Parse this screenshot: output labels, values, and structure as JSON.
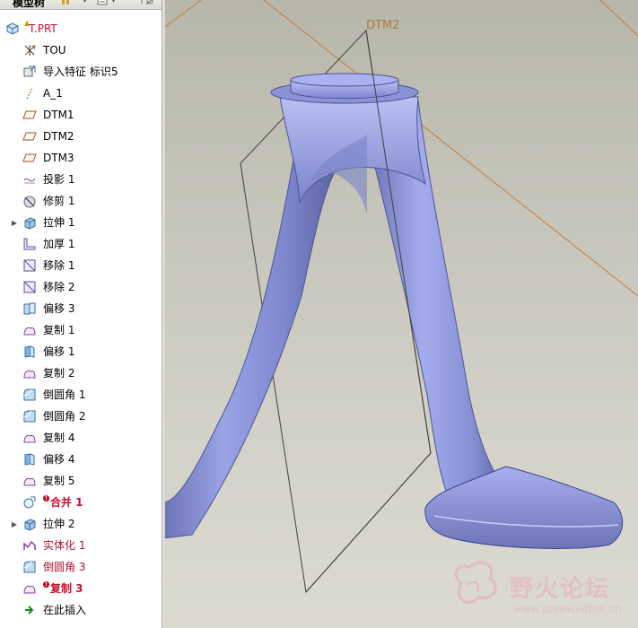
{
  "panel": {
    "title": "模型树"
  },
  "tree": {
    "root": {
      "label": "T.PRT",
      "icon": "part-cube-icon"
    },
    "items": [
      {
        "label": "TOU",
        "icon": "coordinate-system-icon",
        "expand": false,
        "state": "normal"
      },
      {
        "label": "导入特征 标识5",
        "icon": "import-feature-icon",
        "expand": false,
        "state": "normal"
      },
      {
        "label": "A_1",
        "icon": "datum-axis-icon",
        "expand": false,
        "state": "normal"
      },
      {
        "label": "DTM1",
        "icon": "datum-plane-icon",
        "expand": false,
        "state": "normal"
      },
      {
        "label": "DTM2",
        "icon": "datum-plane-icon",
        "expand": false,
        "state": "normal"
      },
      {
        "label": "DTM3",
        "icon": "datum-plane-icon",
        "expand": false,
        "state": "normal"
      },
      {
        "label": "投影 1",
        "icon": "project-curve-icon",
        "expand": false,
        "state": "normal"
      },
      {
        "label": "修剪 1",
        "icon": "trim-icon",
        "expand": false,
        "state": "normal"
      },
      {
        "label": "拉伸 1",
        "icon": "extrude-icon",
        "expand": true,
        "state": "normal"
      },
      {
        "label": "加厚 1",
        "icon": "thicken-icon",
        "expand": false,
        "state": "normal"
      },
      {
        "label": "移除 1",
        "icon": "remove-icon",
        "expand": false,
        "state": "normal"
      },
      {
        "label": "移除 2",
        "icon": "remove-icon",
        "expand": false,
        "state": "normal"
      },
      {
        "label": "偏移 3",
        "icon": "offset-icon",
        "expand": false,
        "state": "normal"
      },
      {
        "label": "复制 1",
        "icon": "copy-surface-icon",
        "expand": false,
        "state": "normal"
      },
      {
        "label": "偏移 1",
        "icon": "offset-surface-icon",
        "expand": false,
        "state": "normal"
      },
      {
        "label": "复制 2",
        "icon": "copy-surface-icon",
        "expand": false,
        "state": "normal"
      },
      {
        "label": "倒圆角 1",
        "icon": "round-icon",
        "expand": false,
        "state": "normal"
      },
      {
        "label": "倒圆角 2",
        "icon": "round-icon",
        "expand": false,
        "state": "normal"
      },
      {
        "label": "复制 4",
        "icon": "copy-surface-icon",
        "expand": false,
        "state": "normal"
      },
      {
        "label": "偏移 4",
        "icon": "offset-surface-icon",
        "expand": false,
        "state": "normal"
      },
      {
        "label": "复制 5",
        "icon": "copy-surface-icon",
        "expand": false,
        "state": "normal"
      },
      {
        "label": "合并 1",
        "icon": "merge-icon",
        "expand": false,
        "state": "failed"
      },
      {
        "label": "拉伸 2",
        "icon": "extrude-icon",
        "expand": true,
        "state": "normal"
      },
      {
        "label": "实体化 1",
        "icon": "solidify-icon",
        "expand": false,
        "state": "red"
      },
      {
        "label": "倒圆角 3",
        "icon": "round-icon",
        "expand": false,
        "state": "red"
      },
      {
        "label": "复制 3",
        "icon": "copy-surface-icon",
        "expand": false,
        "state": "failed-red"
      },
      {
        "label": "在此插入",
        "icon": "insert-here-arrow-icon",
        "expand": false,
        "state": "normal"
      }
    ]
  },
  "viewport": {
    "datum_label": "DTM2",
    "model_color": "#8f98dc"
  },
  "watermark": {
    "title": "野火论坛",
    "url": "www.proewildfire.cn"
  },
  "colors": {
    "failed_text": "#c8102e",
    "datum_plane_line": "#c87b3c",
    "model_fill": "#8f98dc"
  }
}
